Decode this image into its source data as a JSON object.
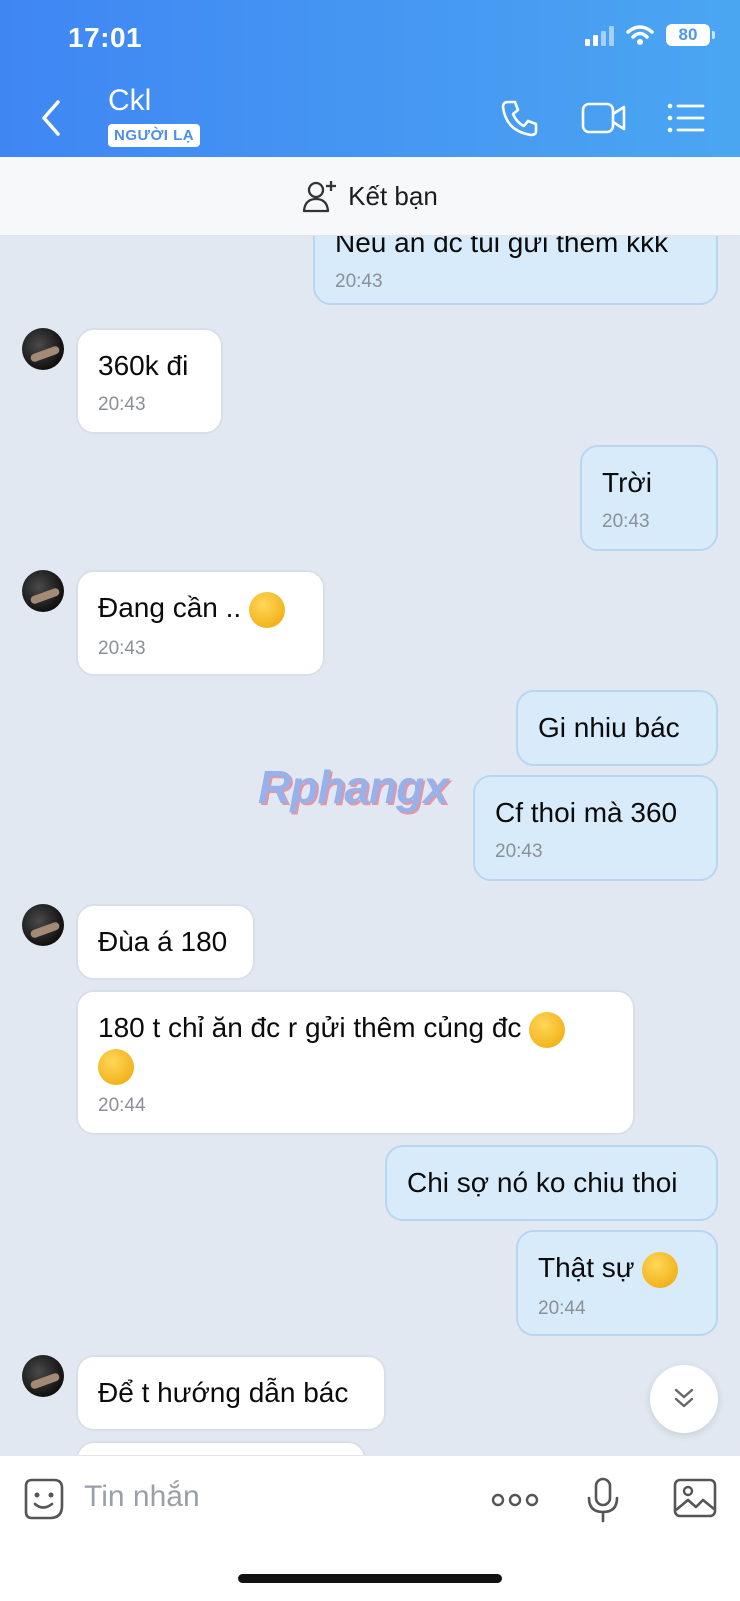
{
  "status_bar": {
    "time": "17:01",
    "battery": "80"
  },
  "header": {
    "contact_name": "Ckl",
    "badge": "NGƯỜI LẠ"
  },
  "add_friend": {
    "label": "Kết bạn"
  },
  "messages": [
    {
      "dir": "out",
      "text": "Nếu ăn đc tui gửi thêm kkk",
      "time": "20:43"
    },
    {
      "dir": "in",
      "text": "360k đi",
      "time": "20:43"
    },
    {
      "dir": "out",
      "text": "Trời",
      "time": "20:43"
    },
    {
      "dir": "in",
      "text": "Đang cần ..",
      "time": "20:43"
    },
    {
      "dir": "out",
      "text": "Gi nhiu bác",
      "time": ""
    },
    {
      "dir": "out",
      "text": "Cf thoi mà 360",
      "time": "20:43"
    },
    {
      "dir": "in",
      "text": "Đùa á 180",
      "time": ""
    },
    {
      "dir": "in",
      "text": "180 t chỉ ăn đc r gửi thêm củng đc",
      "time": "20:44"
    },
    {
      "dir": "out",
      "text": "Chi sợ nó ko chiu thoi",
      "time": ""
    },
    {
      "dir": "out",
      "text": "Thật sự",
      "time": "20:44"
    },
    {
      "dir": "in",
      "text": "Để t hướng dẫn bác",
      "time": ""
    }
  ],
  "watermark": "Rphangx",
  "input": {
    "placeholder": "Tin nhắn"
  },
  "icons": [
    "back-icon",
    "phone-icon",
    "video-icon",
    "menu-list-icon",
    "add-user-icon",
    "chevron-down-double-icon",
    "sticker-icon",
    "more-icon",
    "microphone-icon",
    "image-icon"
  ]
}
